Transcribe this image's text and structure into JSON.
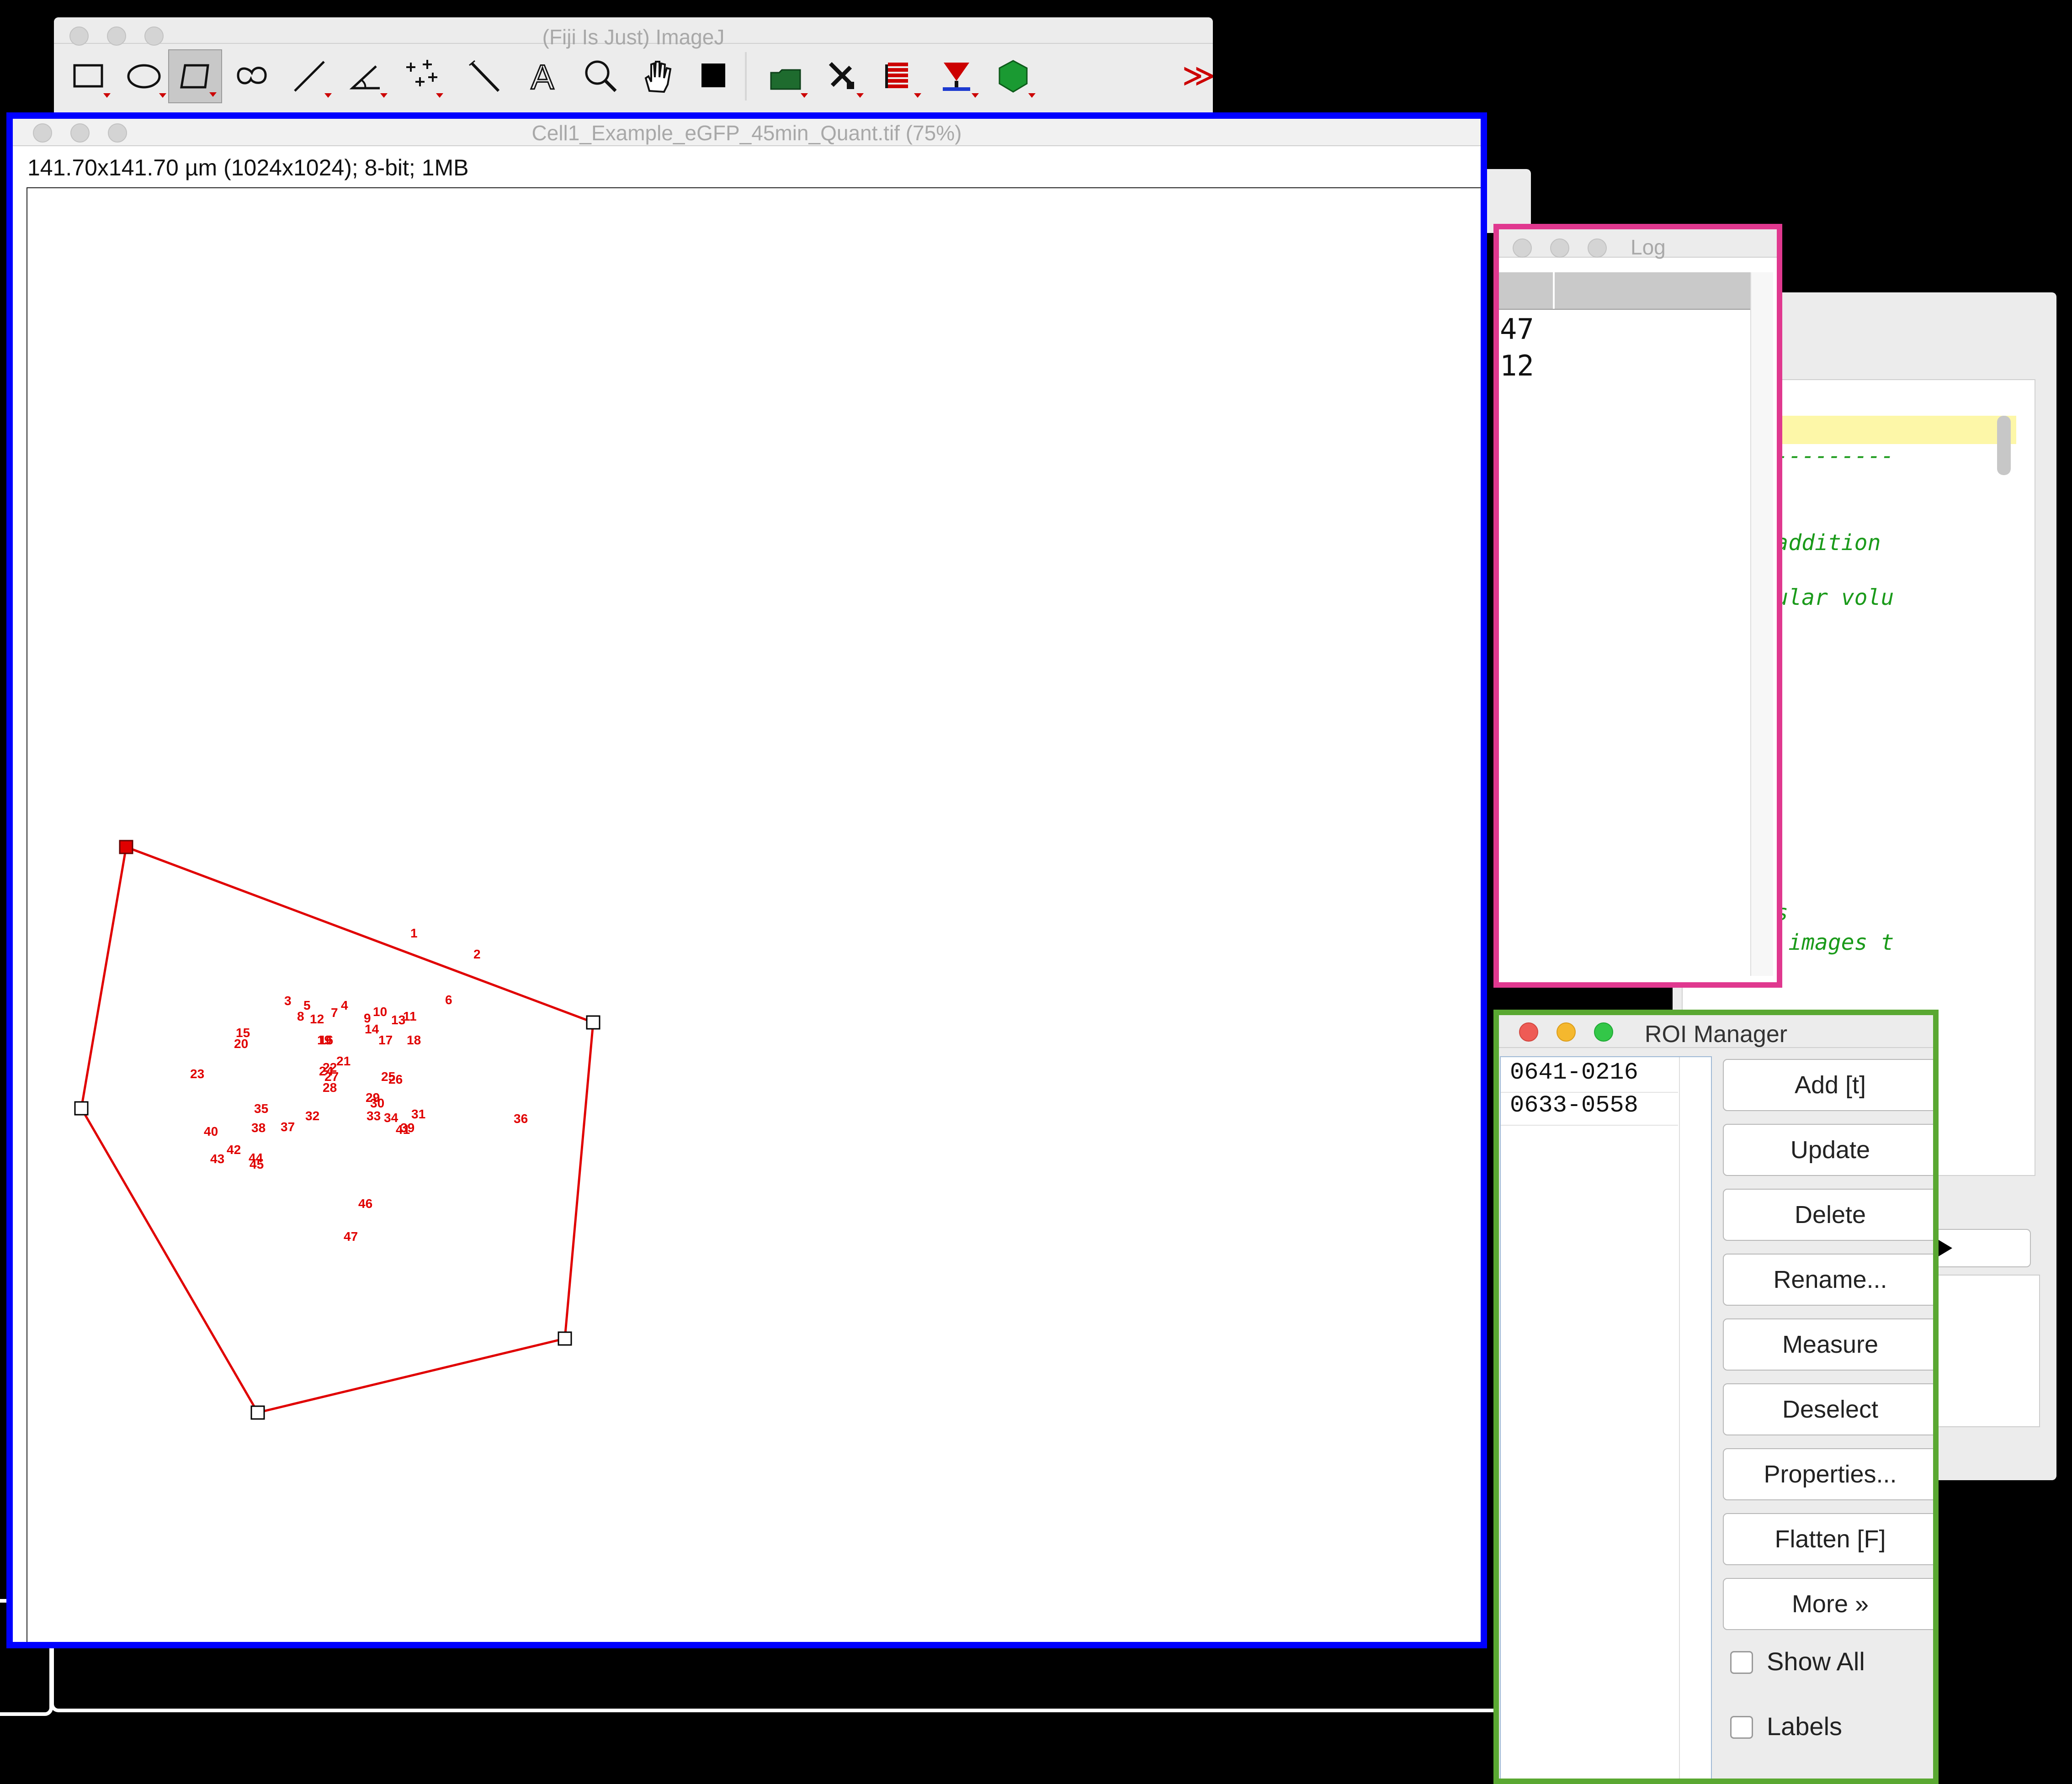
{
  "imagej": {
    "title": "(Fiji Is Just) ImageJ",
    "tools": [
      {
        "name": "rectangle-tool-icon"
      },
      {
        "name": "oval-tool-icon"
      },
      {
        "name": "polygon-tool-icon"
      },
      {
        "name": "freehand-tool-icon"
      },
      {
        "name": "line-tool-icon"
      },
      {
        "name": "angle-tool-icon"
      },
      {
        "name": "multipoint-tool-icon"
      },
      {
        "name": "wand-tool-icon"
      },
      {
        "name": "text-tool-icon",
        "glyph": "A"
      },
      {
        "name": "magnifier-tool-icon"
      },
      {
        "name": "hand-tool-icon"
      },
      {
        "name": "color-picker-icon"
      },
      {
        "name": "open-folder-icon"
      },
      {
        "name": "developer-tools-icon"
      },
      {
        "name": "stack-tools-icon"
      },
      {
        "name": "lut-tools-icon"
      },
      {
        "name": "3d-viewer-icon"
      },
      {
        "name": "more-tools-icon",
        "glyph": "≫"
      }
    ]
  },
  "image_window": {
    "title": "Cell1_Example_eGFP_45min_Quant.tif (75%)",
    "info": "141.70x141.70 µm (1024x1024); 8-bit; 1MB",
    "point_labels": [
      "1",
      "2",
      "3",
      "4",
      "5",
      "6",
      "7",
      "8",
      "9",
      "10",
      "11",
      "12",
      "13",
      "14",
      "15",
      "16",
      "17",
      "18",
      "19",
      "20",
      "21",
      "22",
      "23",
      "24",
      "25",
      "26",
      "27",
      "28",
      "29",
      "30",
      "31",
      "32",
      "33",
      "34",
      "35",
      "36",
      "37",
      "38",
      "39",
      "40",
      "41",
      "42",
      "43",
      "44",
      "45",
      "46",
      "47"
    ]
  },
  "log_window": {
    "title": "Log",
    "lines": [
      "47",
      "12"
    ]
  },
  "editor": {
    "lines": [
      "Biotin addition",
      "le cellular volu",
      "pictures",
      "riginal images t"
    ],
    "separator": "----------------"
  },
  "roi_manager": {
    "title": "ROI Manager",
    "items": [
      "0641-0216",
      "0633-0558"
    ],
    "buttons": [
      "Add [t]",
      "Update",
      "Delete",
      "Rename...",
      "Measure",
      "Deselect",
      "Properties...",
      "Flatten [F]",
      "More »"
    ],
    "checkboxes": [
      "Show All",
      "Labels"
    ]
  },
  "colors": {
    "image_window_highlight": "#0000ff",
    "log_highlight": "#e0388f",
    "roi_highlight": "#5aa832",
    "roi_color": "#e00000",
    "code_comment": "#1a9a1a"
  }
}
